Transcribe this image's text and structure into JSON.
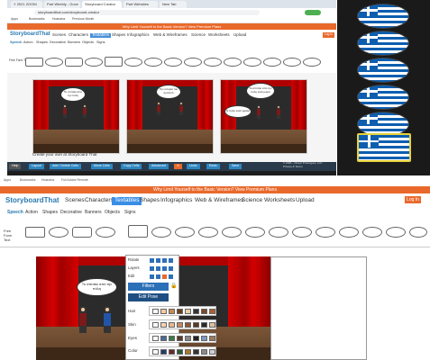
{
  "top": {
    "tabs": [
      "Y 2021 ZOOM",
      "Part Weebly - Gove",
      "Storyboard Creator",
      "Part Websites",
      "New Tab"
    ],
    "url": "storyboardthat.com/storyboard-creator",
    "bookmarks": [
      "Apps",
      "Bookmarks",
      "Hoanaha",
      "Previous Month"
    ],
    "promo": "Why Limit Yourself to the Basic Version?   View Premium Plans",
    "logo": "StoryboardThat",
    "nav": [
      "Scenes",
      "Characters",
      "Textables",
      "Shapes",
      "Infographics",
      "Web & Wireframes",
      "Science",
      "Worksheets",
      "Upload"
    ],
    "login": "Log In",
    "subnav": [
      "Speech",
      "Action",
      "Shapes",
      "Decorative",
      "Banners",
      "Objects",
      "Signs"
    ],
    "freeform_label": "Free Form Text",
    "panel_bubbles": [
      [
        "Το σπιτάκι από την πόλη"
      ],
      [
        "Την ιστορία του ζωντανά"
      ],
      [
        "Το σπιτάκι από την πόλη είναι μικρό",
        "Η πόλη είναι γκρίζα"
      ]
    ],
    "caption": "Create your own at Storyboard That",
    "buttons": [
      "Help",
      "Layout",
      "Add / Delete Cells",
      "Move Cells",
      "Copy Cells",
      "Advanced",
      "Undo",
      "Redo",
      "Save"
    ],
    "copyright": "© 2021 - Clever Prototypes, LLC Privacy & Terms"
  },
  "bottom": {
    "bookmarks": [
      "Apps",
      "Bookmarks",
      "Hoanaha",
      "Full Adobe Remote"
    ],
    "promo": "Why Limit Yourself to the Basic Version?   View Premium Plans",
    "logo": "StoryboardThat",
    "nav": [
      "Scenes",
      "Characters",
      "Textables",
      "Shapes",
      "Infographics",
      "Web & Wireframes",
      "Science",
      "Worksheets",
      "Upload"
    ],
    "login": "Log In",
    "subnav": [
      "Speech",
      "Action",
      "Shapes",
      "Decorative",
      "Banners",
      "Objects",
      "Signs"
    ],
    "freeform_label": "Free Form Text",
    "bubble": "Το σπιτάκι από την πόλη",
    "menu": {
      "rotate": "Rotate",
      "layers": "Layers",
      "edit": "Edit",
      "filters": "Filters",
      "edit_pose": "Edit Pose",
      "rows": [
        "Hair",
        "Skin",
        "Eyes",
        "Color"
      ]
    }
  },
  "colors": {
    "accent": "#e9692c",
    "brand": "#2a7ab0",
    "curtain": "#d40000",
    "stage": "#3a2316"
  }
}
